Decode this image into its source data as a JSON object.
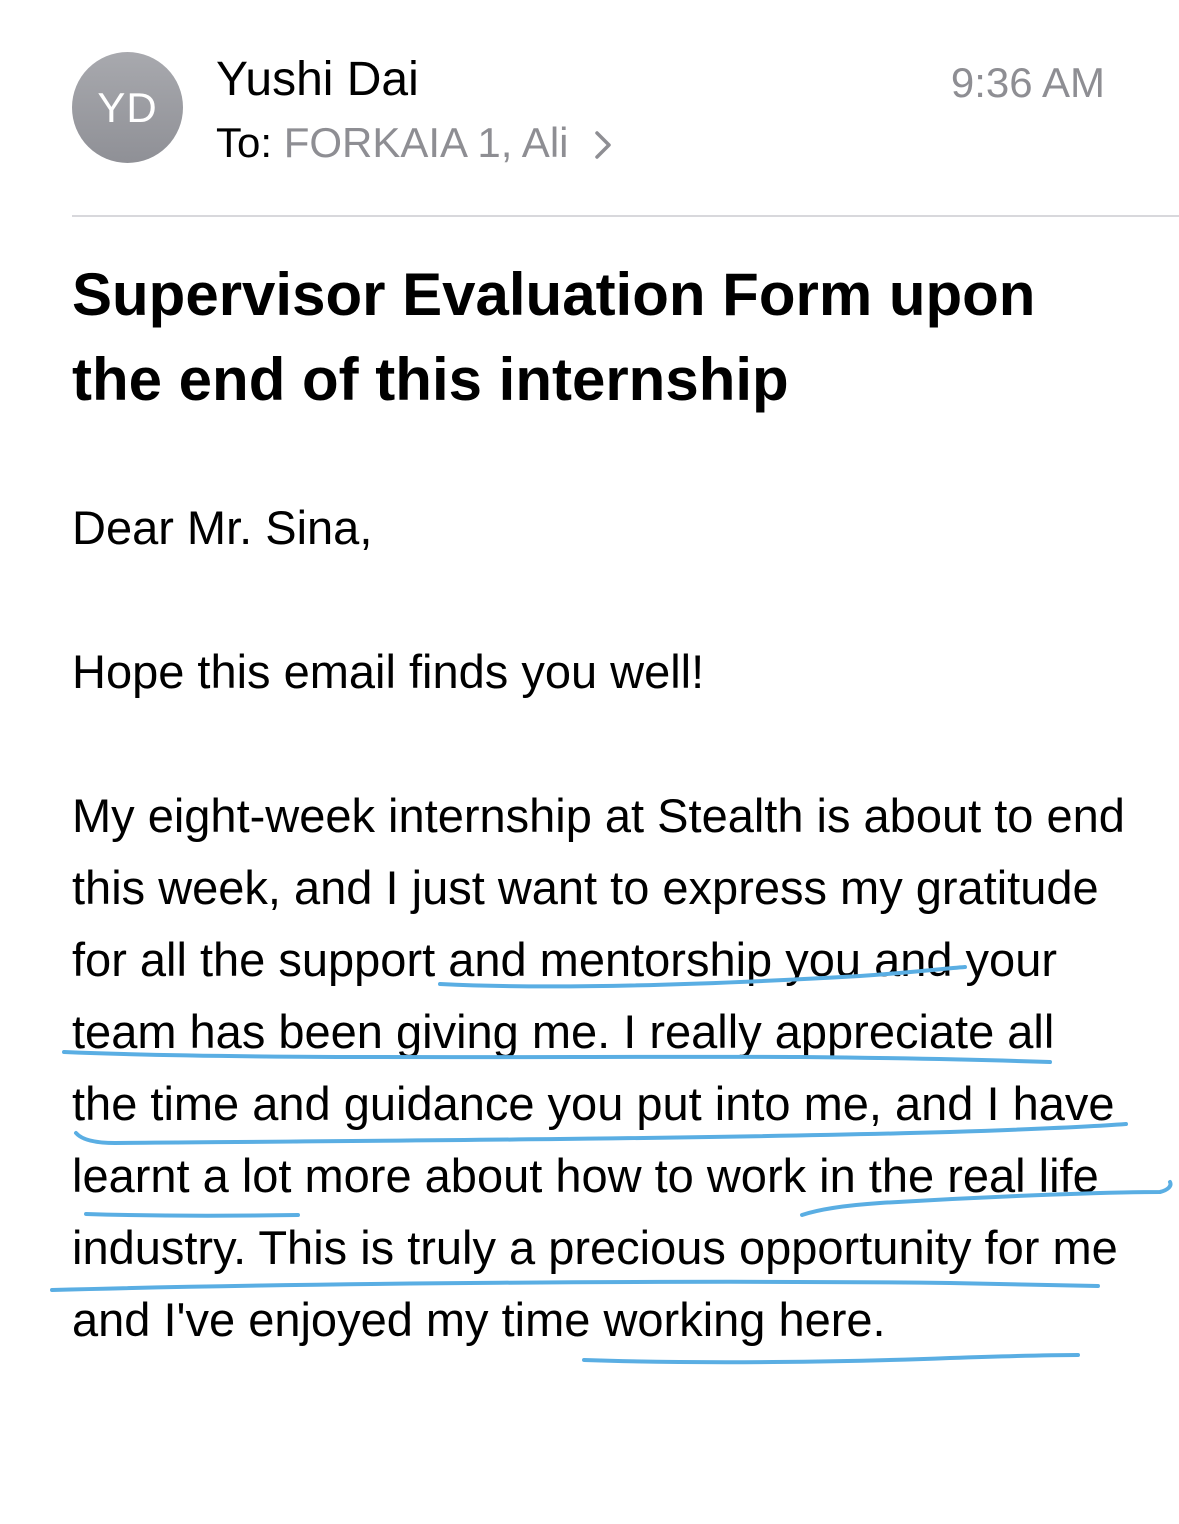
{
  "header": {
    "avatar_initials": "YD",
    "sender_name": "Yushi Dai",
    "time": "9:36 AM",
    "to_label": "To:",
    "recipients": "FORKAIA 1, Ali",
    "avatar_color": "#9a9ba0",
    "secondary_text_color": "#8e8e93"
  },
  "email": {
    "subject": "Supervisor Evaluation Form upon the end of this internship",
    "greeting": "Dear Mr. Sina,",
    "paragraph_1": "Hope this email finds you well!",
    "paragraph_2": "My eight-week internship at Stealth is about to end this week, and I just want to express my gratitude for all the support and mentorship you and your team has been giving me. I really appreciate all the time and guidance you put into me, and I have learnt a lot more about how to work in the real life industry. This is truly a precious opportunity for me and I've enjoyed my time working here."
  },
  "annotations": {
    "underline_color": "#5aaee3",
    "underlines": [
      "all the support and mentorship you and your team has been giving me. I really appreciate all the time and guidance",
      "a lot more about how to work in the real life",
      "precious opportunity"
    ]
  }
}
